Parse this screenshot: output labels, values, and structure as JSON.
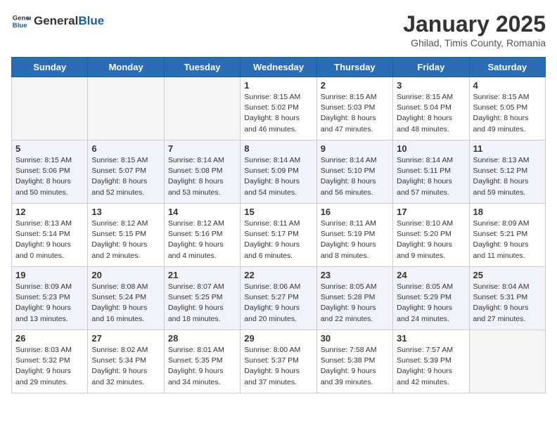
{
  "logo": {
    "general": "General",
    "blue": "Blue"
  },
  "title": "January 2025",
  "subtitle": "Ghilad, Timis County, Romania",
  "weekdays": [
    "Sunday",
    "Monday",
    "Tuesday",
    "Wednesday",
    "Thursday",
    "Friday",
    "Saturday"
  ],
  "weeks": [
    [
      {
        "day": "",
        "info": ""
      },
      {
        "day": "",
        "info": ""
      },
      {
        "day": "",
        "info": ""
      },
      {
        "day": "1",
        "info": "Sunrise: 8:15 AM\nSunset: 5:02 PM\nDaylight: 8 hours\nand 46 minutes."
      },
      {
        "day": "2",
        "info": "Sunrise: 8:15 AM\nSunset: 5:03 PM\nDaylight: 8 hours\nand 47 minutes."
      },
      {
        "day": "3",
        "info": "Sunrise: 8:15 AM\nSunset: 5:04 PM\nDaylight: 8 hours\nand 48 minutes."
      },
      {
        "day": "4",
        "info": "Sunrise: 8:15 AM\nSunset: 5:05 PM\nDaylight: 8 hours\nand 49 minutes."
      }
    ],
    [
      {
        "day": "5",
        "info": "Sunrise: 8:15 AM\nSunset: 5:06 PM\nDaylight: 8 hours\nand 50 minutes."
      },
      {
        "day": "6",
        "info": "Sunrise: 8:15 AM\nSunset: 5:07 PM\nDaylight: 8 hours\nand 52 minutes."
      },
      {
        "day": "7",
        "info": "Sunrise: 8:14 AM\nSunset: 5:08 PM\nDaylight: 8 hours\nand 53 minutes."
      },
      {
        "day": "8",
        "info": "Sunrise: 8:14 AM\nSunset: 5:09 PM\nDaylight: 8 hours\nand 54 minutes."
      },
      {
        "day": "9",
        "info": "Sunrise: 8:14 AM\nSunset: 5:10 PM\nDaylight: 8 hours\nand 56 minutes."
      },
      {
        "day": "10",
        "info": "Sunrise: 8:14 AM\nSunset: 5:11 PM\nDaylight: 8 hours\nand 57 minutes."
      },
      {
        "day": "11",
        "info": "Sunrise: 8:13 AM\nSunset: 5:12 PM\nDaylight: 8 hours\nand 59 minutes."
      }
    ],
    [
      {
        "day": "12",
        "info": "Sunrise: 8:13 AM\nSunset: 5:14 PM\nDaylight: 9 hours\nand 0 minutes."
      },
      {
        "day": "13",
        "info": "Sunrise: 8:12 AM\nSunset: 5:15 PM\nDaylight: 9 hours\nand 2 minutes."
      },
      {
        "day": "14",
        "info": "Sunrise: 8:12 AM\nSunset: 5:16 PM\nDaylight: 9 hours\nand 4 minutes."
      },
      {
        "day": "15",
        "info": "Sunrise: 8:11 AM\nSunset: 5:17 PM\nDaylight: 9 hours\nand 6 minutes."
      },
      {
        "day": "16",
        "info": "Sunrise: 8:11 AM\nSunset: 5:19 PM\nDaylight: 9 hours\nand 8 minutes."
      },
      {
        "day": "17",
        "info": "Sunrise: 8:10 AM\nSunset: 5:20 PM\nDaylight: 9 hours\nand 9 minutes."
      },
      {
        "day": "18",
        "info": "Sunrise: 8:09 AM\nSunset: 5:21 PM\nDaylight: 9 hours\nand 11 minutes."
      }
    ],
    [
      {
        "day": "19",
        "info": "Sunrise: 8:09 AM\nSunset: 5:23 PM\nDaylight: 9 hours\nand 13 minutes."
      },
      {
        "day": "20",
        "info": "Sunrise: 8:08 AM\nSunset: 5:24 PM\nDaylight: 9 hours\nand 16 minutes."
      },
      {
        "day": "21",
        "info": "Sunrise: 8:07 AM\nSunset: 5:25 PM\nDaylight: 9 hours\nand 18 minutes."
      },
      {
        "day": "22",
        "info": "Sunrise: 8:06 AM\nSunset: 5:27 PM\nDaylight: 9 hours\nand 20 minutes."
      },
      {
        "day": "23",
        "info": "Sunrise: 8:05 AM\nSunset: 5:28 PM\nDaylight: 9 hours\nand 22 minutes."
      },
      {
        "day": "24",
        "info": "Sunrise: 8:05 AM\nSunset: 5:29 PM\nDaylight: 9 hours\nand 24 minutes."
      },
      {
        "day": "25",
        "info": "Sunrise: 8:04 AM\nSunset: 5:31 PM\nDaylight: 9 hours\nand 27 minutes."
      }
    ],
    [
      {
        "day": "26",
        "info": "Sunrise: 8:03 AM\nSunset: 5:32 PM\nDaylight: 9 hours\nand 29 minutes."
      },
      {
        "day": "27",
        "info": "Sunrise: 8:02 AM\nSunset: 5:34 PM\nDaylight: 9 hours\nand 32 minutes."
      },
      {
        "day": "28",
        "info": "Sunrise: 8:01 AM\nSunset: 5:35 PM\nDaylight: 9 hours\nand 34 minutes."
      },
      {
        "day": "29",
        "info": "Sunrise: 8:00 AM\nSunset: 5:37 PM\nDaylight: 9 hours\nand 37 minutes."
      },
      {
        "day": "30",
        "info": "Sunrise: 7:58 AM\nSunset: 5:38 PM\nDaylight: 9 hours\nand 39 minutes."
      },
      {
        "day": "31",
        "info": "Sunrise: 7:57 AM\nSunset: 5:39 PM\nDaylight: 9 hours\nand 42 minutes."
      },
      {
        "day": "",
        "info": ""
      }
    ]
  ]
}
